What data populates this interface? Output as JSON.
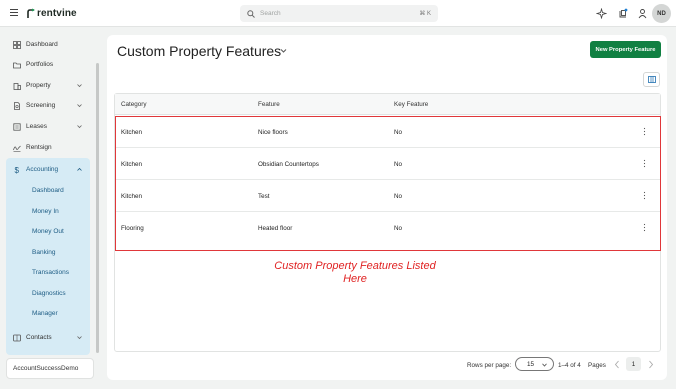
{
  "header": {
    "brand": "rentvine",
    "search_placeholder": "Search",
    "search_shortcut": "⌘ K",
    "icons": [
      "sparkle-icon",
      "notification-icon",
      "user-alert-icon"
    ],
    "avatar_initials": "ND"
  },
  "sidebar": {
    "items": [
      {
        "label": "Dashboard",
        "icon": "grid-icon"
      },
      {
        "label": "Portfolios",
        "icon": "folder-icon"
      },
      {
        "label": "Property",
        "icon": "building-icon"
      },
      {
        "label": "Screening",
        "icon": "document-icon"
      },
      {
        "label": "Leases",
        "icon": "lease-icon"
      },
      {
        "label": "Rentsign",
        "icon": "signature-icon"
      },
      {
        "label": "Accounting",
        "icon": "dollar-icon"
      },
      {
        "label": "Contacts",
        "icon": "contacts-icon"
      }
    ],
    "accounting_items": [
      "Dashboard",
      "Money In",
      "Money Out",
      "Banking",
      "Transactions",
      "Diagnostics",
      "Manager"
    ],
    "account_name": "AccountSuccessDemo"
  },
  "main": {
    "title": "Custom Property Features",
    "new_button": "New Property Feature",
    "columns": [
      "Category",
      "Feature",
      "Key Feature"
    ],
    "rows": [
      {
        "category": "Kitchen",
        "feature": "Nice floors",
        "key": "No"
      },
      {
        "category": "Kitchen",
        "feature": "Obsidian Countertops",
        "key": "No"
      },
      {
        "category": "Kitchen",
        "feature": "Test",
        "key": "No"
      },
      {
        "category": "Flooring",
        "feature": "Heated floor",
        "key": "No"
      }
    ],
    "annotation_line1": "Custom Property Features Listed",
    "annotation_line2": "Here"
  },
  "pagination": {
    "rows_per_page_label": "Rows per page:",
    "rows_per_page_value": "15",
    "range": "1–4 of 4",
    "pages_label": "Pages",
    "current_page": "1"
  },
  "colors": {
    "accent_green": "#108042",
    "accounting_panel": "#d6ebf5",
    "annotation_red": "#e02323"
  }
}
